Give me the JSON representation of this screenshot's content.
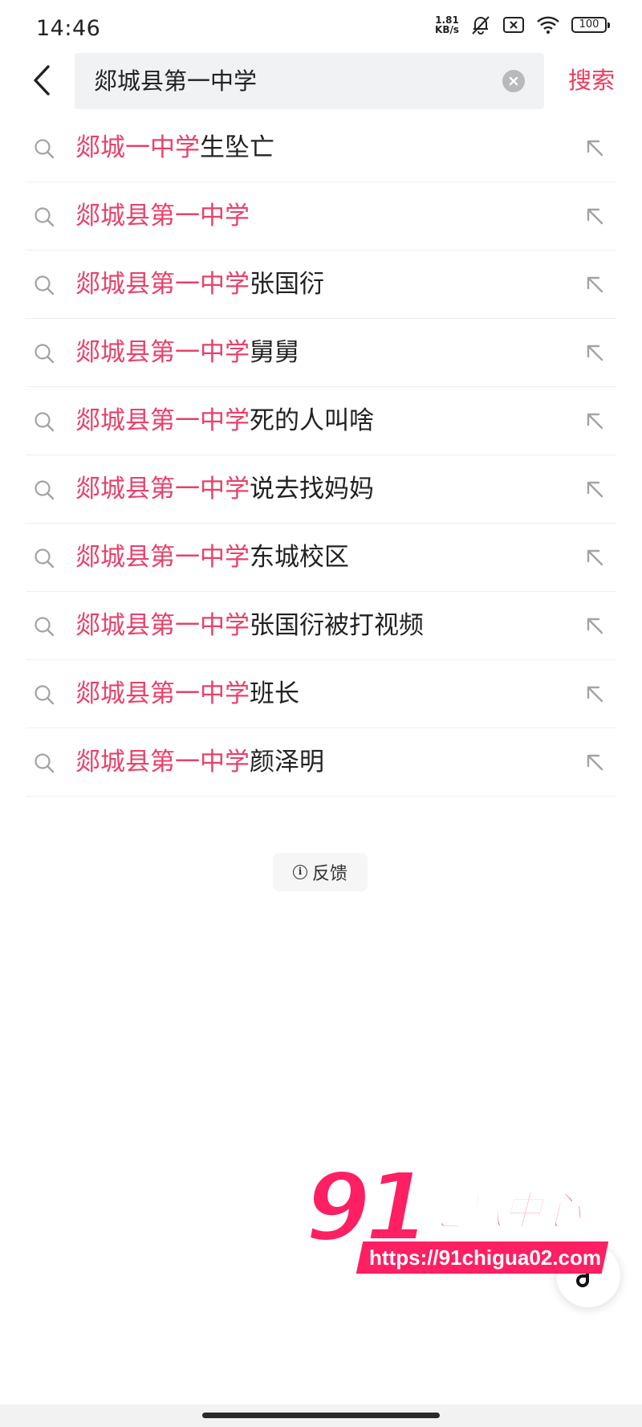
{
  "status_bar": {
    "time": "14:46",
    "net_speed_value": "1.81",
    "net_speed_unit": "KB/s",
    "battery": "100"
  },
  "search": {
    "query": "郯城县第一中学",
    "search_label": "搜索"
  },
  "suggestions": [
    {
      "highlight": "郯城一中学",
      "rest": "生坠亡"
    },
    {
      "highlight": "郯城县第一中学",
      "rest": ""
    },
    {
      "highlight": "郯城县第一中学",
      "rest": "张国衍"
    },
    {
      "highlight": "郯城县第一中学",
      "rest": "舅舅"
    },
    {
      "highlight": "郯城县第一中学",
      "rest": "死的人叫啥"
    },
    {
      "highlight": "郯城县第一中学",
      "rest": "说去找妈妈"
    },
    {
      "highlight": "郯城县第一中学",
      "rest": "东城校区"
    },
    {
      "highlight": "郯城县第一中学",
      "rest": "张国衍被打视频"
    },
    {
      "highlight": "郯城县第一中学",
      "rest": "班长"
    },
    {
      "highlight": "郯城县第一中学",
      "rest": "颜泽明"
    }
  ],
  "feedback": {
    "label": "反馈",
    "icon_char": "i"
  },
  "watermark": {
    "number": "91",
    "name": "吃瓜中心",
    "url": "https://91chigua02.com"
  },
  "colors": {
    "accent": "#ee3a5e",
    "highlight": "#e8416a",
    "watermark": "#ff1f63"
  },
  "icons": {
    "back": "chevron-left-icon",
    "clear": "clear-icon",
    "suggestion": "search-icon",
    "fill": "arrow-up-left-icon",
    "float": "note-icon"
  }
}
